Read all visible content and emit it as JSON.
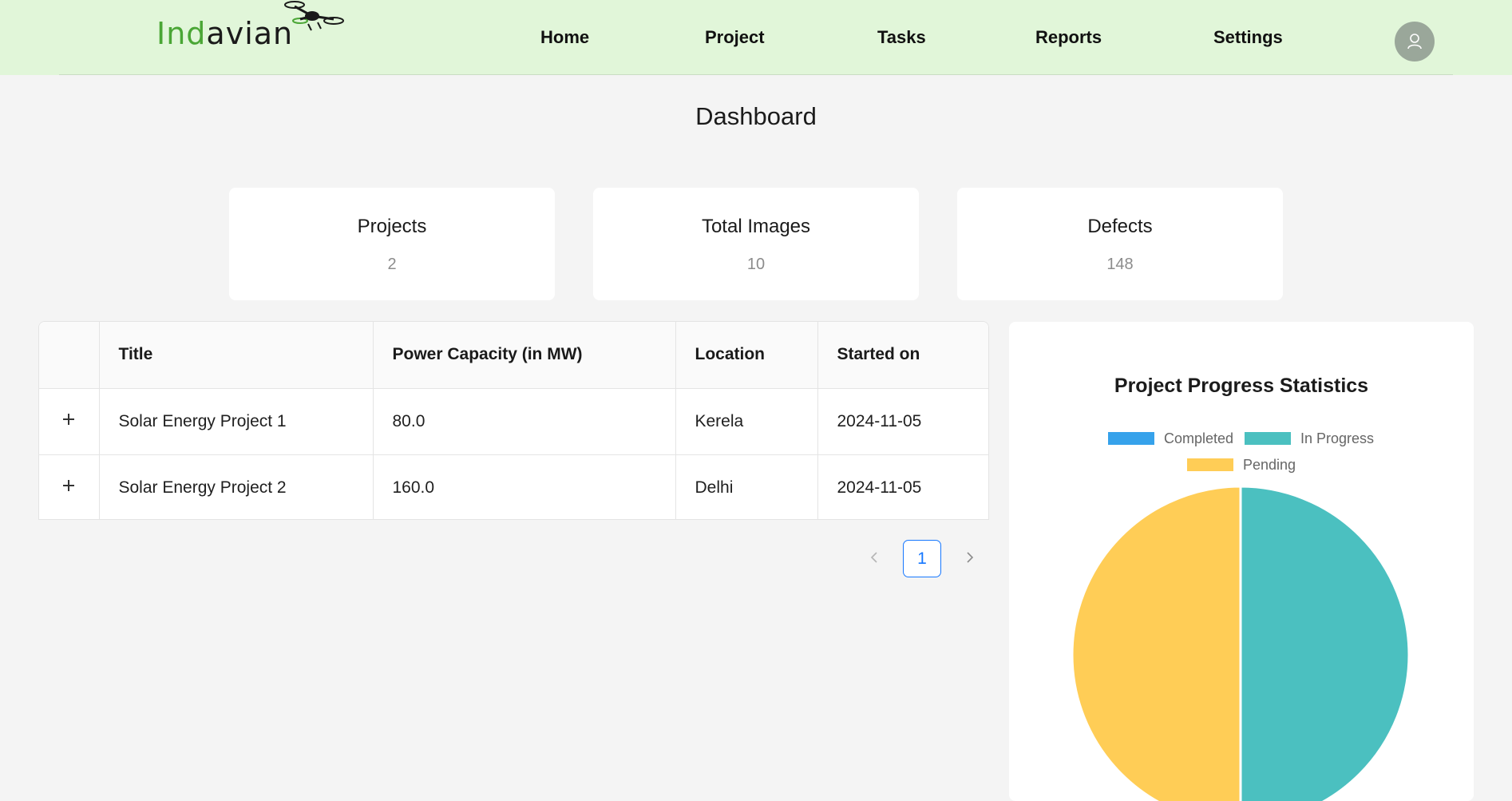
{
  "header": {
    "logo_text_green": "Ind",
    "logo_text_dark": "avian",
    "nav": [
      "Home",
      "Project",
      "Tasks",
      "Reports",
      "Settings"
    ]
  },
  "page_title": "Dashboard",
  "stats": [
    {
      "label": "Projects",
      "value": "2"
    },
    {
      "label": "Total Images",
      "value": "10"
    },
    {
      "label": "Defects",
      "value": "148"
    }
  ],
  "table": {
    "columns": [
      "",
      "Title",
      "Power Capacity (in MW)",
      "Location",
      "Started on"
    ],
    "rows": [
      [
        "Solar Energy Project 1",
        "80.0",
        "Kerela",
        "2024-11-05"
      ],
      [
        "Solar Energy Project 2",
        "160.0",
        "Delhi",
        "2024-11-05"
      ]
    ]
  },
  "pagination": {
    "current_page": "1"
  },
  "chart_data": {
    "type": "pie",
    "title": "Project Progress Statistics",
    "categories": [
      "Completed",
      "In Progress",
      "Pending"
    ],
    "values": [
      0,
      1,
      1
    ],
    "colors": [
      "#36a2eb",
      "#4bc0c0",
      "#ffcd56"
    ],
    "legend_position": "top"
  }
}
